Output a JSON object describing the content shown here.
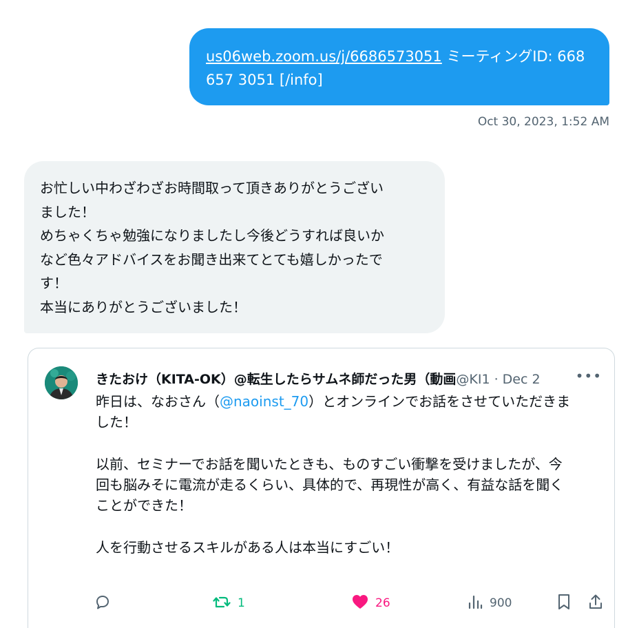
{
  "sent_message": {
    "link_text": "us06web.zoom.us/j/6686573051",
    "text_after_link": " ミーティングID: 668",
    "line2": "657 3051 [/info]",
    "timestamp": "Oct 30, 2023, 1:52 AM"
  },
  "received_message": {
    "lines": [
      "お忙しい中わざわざお時間取って頂きありがとうござい",
      "ました！",
      "めちゃくちゃ勉強になりましたし今後どうすれば良いか",
      "など色々アドバイスをお聞き出来てとても嬉しかったで",
      "す！",
      "本当にありがとうございました！"
    ]
  },
  "quoted_post": {
    "author_name": "きたおけ（KITA-OK）@転生したらサムネ師だった男（動画",
    "handle_date": "@KI1 · Dec 2",
    "body": {
      "line1_prefix": "昨日は、なおさん（",
      "mention": "@naoinst_70",
      "line1_suffix": "）とオンラインでお話をさせていただきま",
      "line2": "した！",
      "line3": "以前、セミナーでお話を聞いたときも、ものすごい衝撃を受けましたが、今",
      "line4": "回も脳みそに電流が走るくらい、具体的で、再現性が高く、有益な話を聞く",
      "line5": "ことができた！",
      "line6": "人を行動させるスキルがある人は本当にすごい！"
    },
    "actions": {
      "reply_icon": "reply-icon",
      "retweet_count": "1",
      "like_count": "26",
      "views_count": "900",
      "bookmark_icon": "bookmark-icon",
      "share_icon": "share-icon"
    },
    "colors": {
      "retweet": "#00ba7c",
      "like": "#f91880",
      "mention": "#1d9bf0",
      "muted": "#536471"
    }
  },
  "colors": {
    "sent_bubble": "#1d9bf0",
    "received_bubble": "#eff3f4"
  }
}
